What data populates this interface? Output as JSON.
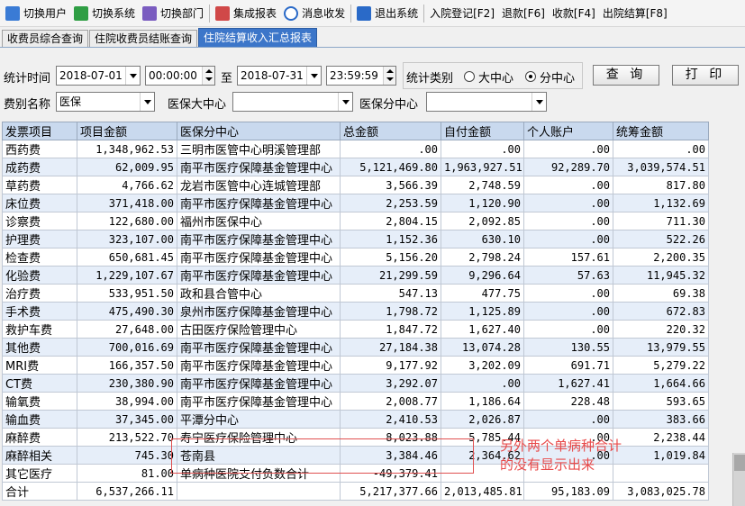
{
  "toolbar": {
    "items": [
      {
        "label": "切换用户",
        "color": "#3a7bd5"
      },
      {
        "label": "切换系统",
        "color": "#2f9e44"
      },
      {
        "label": "切换部门",
        "color": "#7a5cc0"
      },
      {
        "label": "集成报表",
        "color": "#d04848"
      },
      {
        "label": "消息收发",
        "color": "#2a6ac8"
      },
      {
        "label": "退出系统",
        "color": "#2a6ac8"
      }
    ],
    "shortcuts": [
      "入院登记[F2]",
      "退款[F6]",
      "收款[F4]",
      "出院结算[F8]"
    ]
  },
  "tabs": [
    "收费员综合查询",
    "住院收费员结账查询",
    "住院结算收入汇总报表"
  ],
  "active_tab": 2,
  "filters": {
    "period_label": "统计时间",
    "start_date": "2018-07-01",
    "start_time": "00:00:00",
    "to_label": "至",
    "end_date": "2018-07-31",
    "end_time": "23:59:59",
    "type_label": "统计类别",
    "opt_big": "大中心",
    "opt_sub": "分中心",
    "query_btn": "查 询",
    "print_btn": "打 印",
    "fee_label": "费别名称",
    "fee_value": "医保",
    "big_center_label": "医保大中心",
    "big_center_value": "",
    "sub_center_label": "医保分中心",
    "sub_center_value": ""
  },
  "table": {
    "headers": [
      "发票项目",
      "项目金额",
      "医保分中心",
      "总金额",
      "自付金额",
      "个人账户",
      "统筹金额"
    ],
    "rows": [
      [
        "西药费",
        "1,348,962.53",
        "三明市医管中心明溪管理部",
        ".00",
        ".00",
        ".00",
        ".00"
      ],
      [
        "成药费",
        "62,009.95",
        "南平市医疗保障基金管理中心",
        "5,121,469.80",
        "1,963,927.51",
        "92,289.70",
        "3,039,574.51"
      ],
      [
        "草药费",
        "4,766.62",
        "龙岩市医管中心连城管理部",
        "3,566.39",
        "2,748.59",
        ".00",
        "817.80"
      ],
      [
        "床位费",
        "371,418.00",
        "南平市医疗保障基金管理中心",
        "2,253.59",
        "1,120.90",
        ".00",
        "1,132.69"
      ],
      [
        "诊察费",
        "122,680.00",
        "福州市医保中心",
        "2,804.15",
        "2,092.85",
        ".00",
        "711.30"
      ],
      [
        "护理费",
        "323,107.00",
        "南平市医疗保障基金管理中心",
        "1,152.36",
        "630.10",
        ".00",
        "522.26"
      ],
      [
        "检查费",
        "650,681.45",
        "南平市医疗保障基金管理中心",
        "5,156.20",
        "2,798.24",
        "157.61",
        "2,200.35"
      ],
      [
        "化验费",
        "1,229,107.67",
        "南平市医疗保障基金管理中心",
        "21,299.59",
        "9,296.64",
        "57.63",
        "11,945.32"
      ],
      [
        "治疗费",
        "533,951.50",
        "政和县合管中心",
        "547.13",
        "477.75",
        ".00",
        "69.38"
      ],
      [
        "手术费",
        "475,490.30",
        "泉州市医疗保障基金管理中心",
        "1,798.72",
        "1,125.89",
        ".00",
        "672.83"
      ],
      [
        "救护车费",
        "27,648.00",
        "古田医疗保险管理中心",
        "1,847.72",
        "1,627.40",
        ".00",
        "220.32"
      ],
      [
        "其他费",
        "700,016.69",
        "南平市医疗保障基金管理中心",
        "27,184.38",
        "13,074.28",
        "130.55",
        "13,979.55"
      ],
      [
        "MRI费",
        "166,357.50",
        "南平市医疗保障基金管理中心",
        "9,177.92",
        "3,202.09",
        "691.71",
        "5,279.22"
      ],
      [
        "CT费",
        "230,380.90",
        "南平市医疗保障基金管理中心",
        "3,292.07",
        ".00",
        "1,627.41",
        "1,664.66"
      ],
      [
        "输氧费",
        "38,994.00",
        "南平市医疗保障基金管理中心",
        "2,008.77",
        "1,186.64",
        "228.48",
        "593.65"
      ],
      [
        "输血费",
        "37,345.00",
        "平潭分中心",
        "2,410.53",
        "2,026.87",
        ".00",
        "383.66"
      ],
      [
        "麻醉费",
        "213,522.70",
        "寿宁医疗保险管理中心",
        "8,023.88",
        "5,785.44",
        ".00",
        "2,238.44"
      ],
      [
        "麻醉相关",
        "745.30",
        "苍南县",
        "3,384.46",
        "2,364.62",
        ".00",
        "1,019.84"
      ],
      [
        "其它医疗",
        "81.00",
        "单病种医院支付负数合计",
        "-49,379.41",
        "",
        "",
        ""
      ],
      [
        "合计",
        "6,537,266.11",
        "",
        "5,217,377.66",
        "2,013,485.81",
        "95,183.09",
        "3,083,025.78"
      ]
    ]
  },
  "annotation": {
    "line1": "另外两个单病种合计",
    "line2": "的没有显示出来",
    "color": "#e84a4a"
  }
}
